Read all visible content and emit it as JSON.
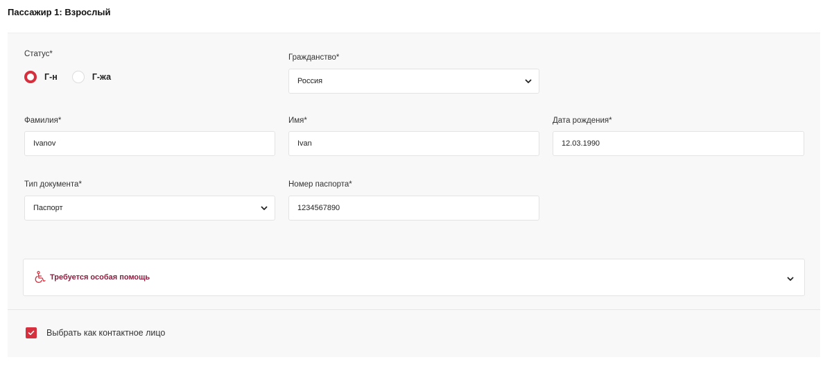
{
  "passenger": {
    "title": "Пассажир 1: Взрослый"
  },
  "status": {
    "label": "Статус*",
    "options": [
      {
        "label": "Г-н",
        "checked": true
      },
      {
        "label": "Г-жа",
        "checked": false
      }
    ]
  },
  "citizenship": {
    "label": "Гражданство*",
    "value": "Россия"
  },
  "last_name": {
    "label": "Фамилия*",
    "value": "Ivanov"
  },
  "first_name": {
    "label": "Имя*",
    "value": "Ivan"
  },
  "birth_date": {
    "label": "Дата рождения*",
    "value": "12.03.1990"
  },
  "doc_type": {
    "label": "Тип документа*",
    "value": "Паспорт"
  },
  "passport_number": {
    "label": "Номер паспорта*",
    "value": "1234567890"
  },
  "special_assistance": {
    "label": "Требуется особая помощь",
    "icon": "wheelchair-icon"
  },
  "contact": {
    "label": "Выбрать как контактное лицо",
    "checked": true
  },
  "colors": {
    "accent": "#d62f3d",
    "assist_text": "#8b1e3f",
    "card_bg": "#f8f8f8"
  }
}
